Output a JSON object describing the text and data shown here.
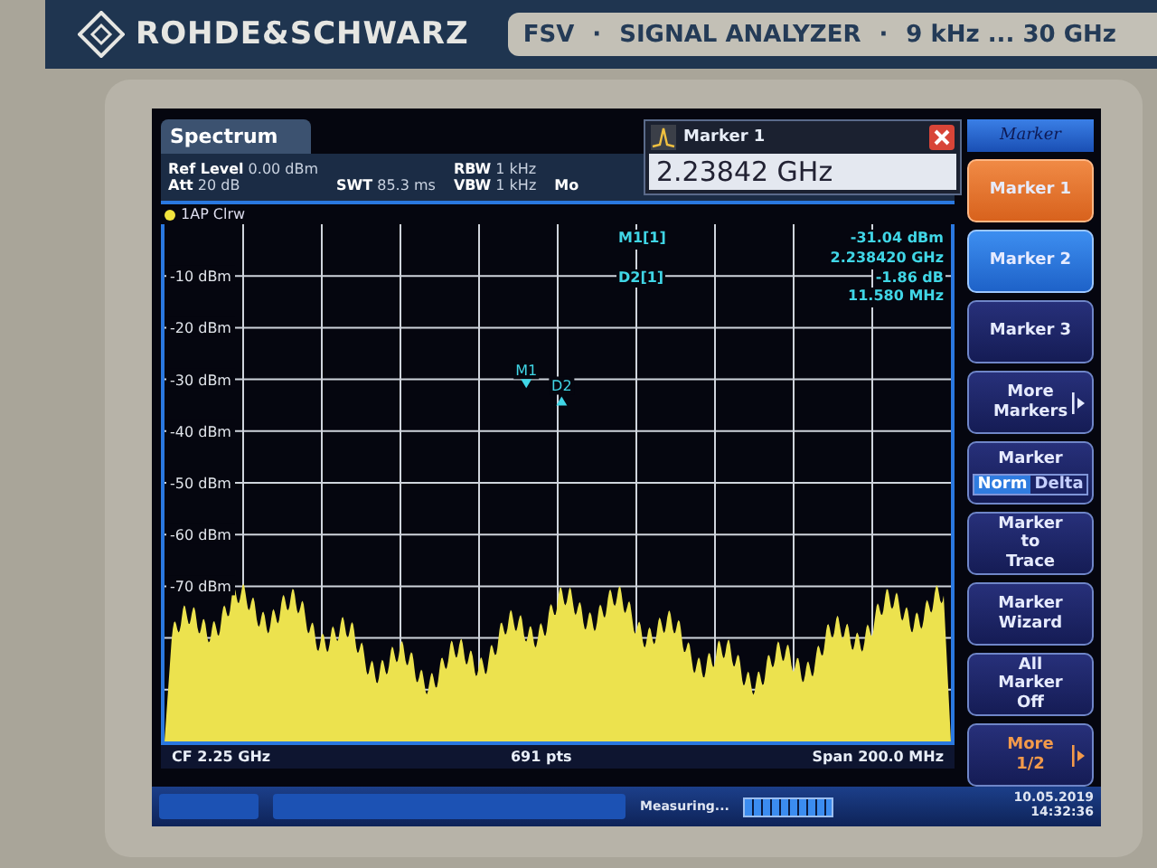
{
  "device": {
    "brand": "ROHDE&SCHWARZ",
    "model_plate": [
      "FSV",
      "·",
      "SIGNAL ANALYZER",
      "·",
      "9 kHz ... 30 GHz"
    ]
  },
  "tab": {
    "label": "Spectrum",
    "selected": true
  },
  "settings": [
    {
      "label": "Ref Level",
      "value": "0.00 dBm"
    },
    {
      "label": "Att",
      "value": "20 dB"
    },
    {
      "label": "SWT",
      "value": "85.3 ms"
    },
    {
      "label": "RBW",
      "value": "1 kHz"
    },
    {
      "label": "VBW",
      "value": "1 kHz"
    },
    {
      "label": "Mo"
    }
  ],
  "marker_dialog": {
    "title": "Marker 1",
    "value": "2.23842 GHz"
  },
  "trace_label": "1AP Clrw",
  "y_axis_labels": [
    "-10 dBm",
    "-20 dBm",
    "-30 dBm",
    "-40 dBm",
    "-50 dBm",
    "-60 dBm",
    "-70 dBm"
  ],
  "markers": [
    {
      "label": "M1",
      "kind": "normal"
    },
    {
      "label": "D2",
      "kind": "delta"
    }
  ],
  "readouts": [
    {
      "name": "M1[1]",
      "values": [
        "-31.04 dBm",
        "2.238420 GHz"
      ]
    },
    {
      "name": "D2[1]",
      "values": [
        "-1.86 dB",
        "11.580 MHz"
      ]
    }
  ],
  "footer": {
    "center_frequency": "CF 2.25 GHz",
    "points": "691 pts",
    "span": "Span 200.0 MHz"
  },
  "status": {
    "message": "Measuring...",
    "progress": {
      "level": 1
    },
    "date": "10.05.2019",
    "time": "14:32:36"
  },
  "softkey_menu": "Marker",
  "softkeys": [
    {
      "kind": "plain",
      "lines": [
        "Marker 1"
      ],
      "selected": true,
      "active": false
    },
    {
      "kind": "plain",
      "lines": [
        "Marker 2"
      ],
      "selected": false,
      "active": true
    },
    {
      "kind": "plain",
      "lines": [
        "Marker 3"
      ],
      "selected": false,
      "active": false
    },
    {
      "kind": "submenu",
      "lines": [
        "More",
        "Markers"
      ],
      "selected": false,
      "active": false
    },
    {
      "kind": "toggle",
      "lines": [
        "Marker"
      ],
      "options": [
        {
          "label": "Norm",
          "selected": true
        },
        {
          "label": "Delta",
          "selected": false
        }
      ],
      "selected": false,
      "active": false
    },
    {
      "kind": "plain",
      "lines": [
        "Marker",
        "to",
        "Trace"
      ],
      "selected": false,
      "active": false
    },
    {
      "kind": "plain",
      "lines": [
        "Marker",
        "Wizard"
      ],
      "selected": false,
      "active": false
    },
    {
      "kind": "plain",
      "lines": [
        "All",
        "Marker",
        "Off"
      ],
      "selected": false,
      "active": false
    },
    {
      "kind": "more",
      "lines": [
        "More",
        "1/2"
      ],
      "selected": false,
      "active": false
    }
  ]
}
